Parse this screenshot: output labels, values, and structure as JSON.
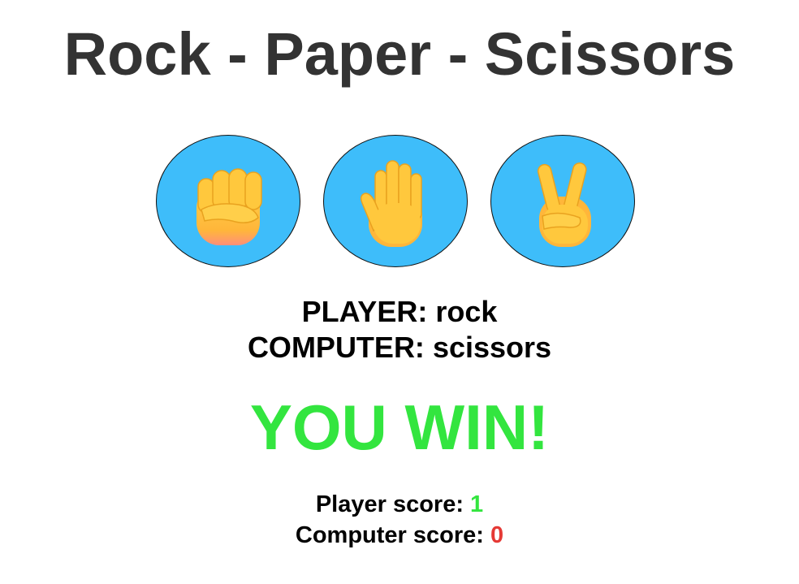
{
  "header": {
    "title": "Rock - Paper - Scissors"
  },
  "choices": [
    {
      "id": "rock",
      "icon": "fist-icon"
    },
    {
      "id": "paper",
      "icon": "raised-hand-icon"
    },
    {
      "id": "scissors",
      "icon": "victory-hand-icon"
    }
  ],
  "round": {
    "player_label": "PLAYER:",
    "player_choice": "rock",
    "computer_label": "COMPUTER:",
    "computer_choice": "scissors"
  },
  "result": {
    "text": "YOU WIN!",
    "color": "#33e53f"
  },
  "scores": {
    "player_label": "Player score:",
    "player_value": "1",
    "player_color": "#33e53f",
    "computer_label": "Computer score:",
    "computer_value": "0",
    "computer_color": "#e53935"
  },
  "colors": {
    "title": "#333333",
    "button_bg": "#3ebdfa",
    "hand_fill": "#ffc83d"
  }
}
